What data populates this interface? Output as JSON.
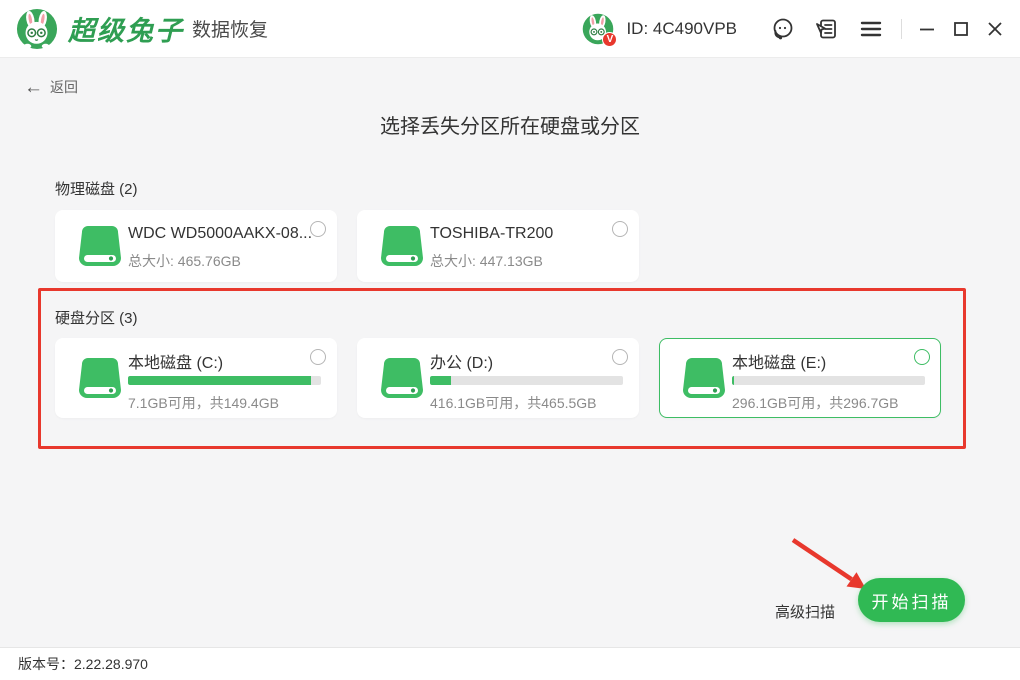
{
  "titlebar": {
    "brand": "超级兔子",
    "product": "数据恢复",
    "user_id": "ID: 4C490VPB",
    "colors": {
      "brand_green": "#2f9e52",
      "badge_red": "#e8382d"
    }
  },
  "toolbar": {
    "back_label": "返回"
  },
  "page": {
    "title": "选择丢失分区所在硬盘或分区"
  },
  "physical_disks": {
    "heading": "物理磁盘 (2)",
    "items": [
      {
        "name": "WDC WD5000AAKX-08...",
        "size_label": "总大小: 465.76GB",
        "selected": false
      },
      {
        "name": "TOSHIBA-TR200",
        "size_label": "总大小: 447.13GB",
        "selected": false
      }
    ]
  },
  "partitions": {
    "heading": "硬盘分区 (3)",
    "items": [
      {
        "name": "本地磁盘 (C:)",
        "usage_label": "7.1GB可用，共149.4GB",
        "used_percent": 95,
        "selected": false
      },
      {
        "name": "办公 (D:)",
        "usage_label": "416.1GB可用，共465.5GB",
        "used_percent": 11,
        "selected": false
      },
      {
        "name": "本地磁盘 (E:)",
        "usage_label": "296.1GB可用，共296.7GB",
        "used_percent": 1,
        "selected": true
      }
    ]
  },
  "actions": {
    "advanced_scan_label": "高级扫描",
    "start_scan_label": "开始扫描"
  },
  "footer": {
    "version_label": "版本号：2.22.28.970"
  },
  "annotations": {
    "highlight_color": "#e8382d"
  },
  "colors": {
    "accent_green": "#3ebd64",
    "button_green": "#30b954",
    "background": "#f5f5f6"
  }
}
